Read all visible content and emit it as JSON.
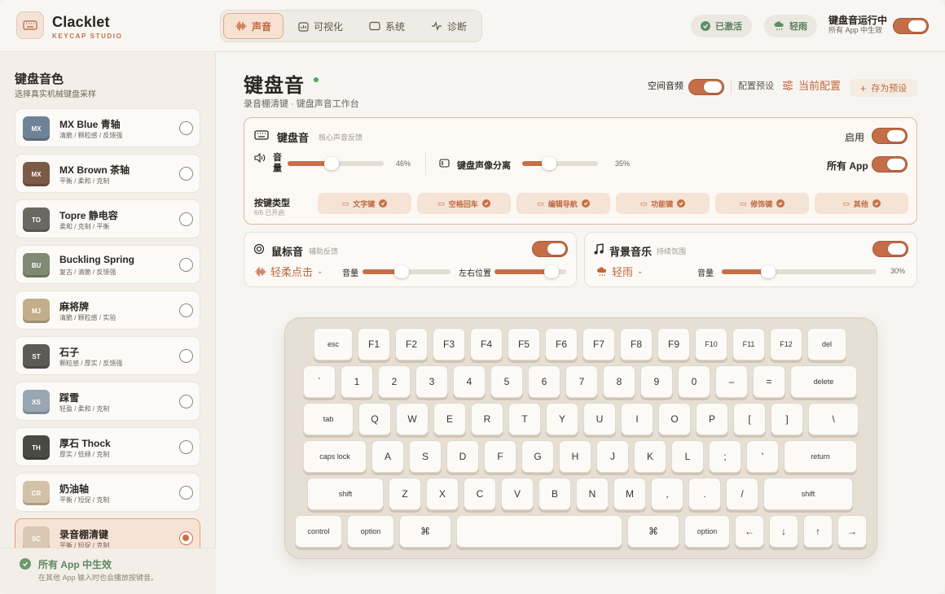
{
  "brand": {
    "title": "Clacklet",
    "subtitle": "KEYCAP STUDIO"
  },
  "nav": [
    {
      "label": "声音",
      "active": true
    },
    {
      "label": "可视化"
    },
    {
      "label": "系统"
    },
    {
      "label": "诊断"
    }
  ],
  "status": {
    "activated": "已激活",
    "weather": "轻雨",
    "running_title": "键盘音运行中",
    "running_sub": "所有 App 中生效"
  },
  "sidebar": {
    "title": "键盘音色",
    "subtitle": "选择真实机械键盘采样",
    "items": [
      {
        "code": "MX",
        "name": "MX Blue 青轴",
        "desc": "清脆 / 颗粒感 / 反馈强",
        "color": "#6f8296"
      },
      {
        "code": "MX",
        "name": "MX Brown 茶轴",
        "desc": "平衡 / 柔和 / 克制",
        "color": "#7c5a48"
      },
      {
        "code": "TO",
        "name": "Topre 静电容",
        "desc": "柔和 / 克制 / 平衡",
        "color": "#6b6862"
      },
      {
        "code": "BU",
        "name": "Buckling Spring",
        "desc": "复古 / 清脆 / 反馈强",
        "color": "#7f8a73"
      },
      {
        "code": "MJ",
        "name": "麻将牌",
        "desc": "清脆 / 颗粒感 / 实验",
        "color": "#c2ae8b"
      },
      {
        "code": "ST",
        "name": "石子",
        "desc": "颗粒感 / 厚实 / 反馈强",
        "color": "#5d5b55"
      },
      {
        "code": "XS",
        "name": "踩雪",
        "desc": "轻盈 / 柔和 / 克制",
        "color": "#98a7b3"
      },
      {
        "code": "TH",
        "name": "厚石 Thock",
        "desc": "厚实 / 低频 / 克制",
        "color": "#4a4a45"
      },
      {
        "code": "CR",
        "name": "奶油轴",
        "desc": "平衡 / 短促 / 克制",
        "color": "#d3c2a7"
      },
      {
        "code": "SC",
        "name": "录音棚清键",
        "desc": "平衡 / 短促 / 克制",
        "color": "#d7c9b4",
        "selected": true
      }
    ],
    "footer_title": "所有 App 中生效",
    "footer_sub": "在其他 App 输入时也会播放按键音。"
  },
  "main": {
    "title": "键盘音",
    "subtitle": "录音棚清键 · 键盘声音工作台",
    "spatial": "空间音频",
    "preset_label": "配置预设",
    "current_config": "当前配置",
    "save_preset": "存为预设",
    "keyboard_card": {
      "title": "键盘音",
      "hint": "核心声音反馈",
      "enable": "启用",
      "all_apps": "所有 App",
      "volume_label": "音量",
      "volume": 46,
      "volume_text": "46%",
      "stereo_label": "键盘声像分离",
      "stereo": 35,
      "stereo_text": "35%",
      "key_type_label": "按键类型",
      "key_type_count": "6/6 已开启",
      "key_types": [
        "文字键",
        "空格回车",
        "编辑导航",
        "功能键",
        "修饰键",
        "其他"
      ]
    },
    "mouse_card": {
      "title": "鼠标音",
      "hint": "辅助反馈",
      "preset": "轻柔点击",
      "volume_label": "音量",
      "volume": 44,
      "pan_label": "左右位置",
      "pan": 80
    },
    "music_card": {
      "title": "背景音乐",
      "hint": "持续氛围",
      "preset": "轻雨",
      "volume_label": "音量",
      "volume": 30,
      "volume_text": "30%"
    }
  },
  "keyboard": {
    "row1": [
      "esc",
      "F1",
      "F2",
      "F3",
      "F4",
      "F5",
      "F6",
      "F7",
      "F8",
      "F9",
      "F10",
      "F11",
      "F12",
      "del"
    ],
    "row2": [
      "`",
      "1",
      "2",
      "3",
      "4",
      "5",
      "6",
      "7",
      "8",
      "9",
      "0",
      "–",
      "=",
      "delete"
    ],
    "row3": [
      "tab",
      "Q",
      "W",
      "E",
      "R",
      "T",
      "Y",
      "U",
      "I",
      "O",
      "P",
      "[",
      "]",
      "\\"
    ],
    "row4": [
      "caps lock",
      "A",
      "S",
      "D",
      "F",
      "G",
      "H",
      "J",
      "K",
      "L",
      ";",
      "'",
      "return"
    ],
    "row5": [
      "shift",
      "Z",
      "X",
      "C",
      "V",
      "B",
      "N",
      "M",
      ",",
      ".",
      "/",
      "shift"
    ],
    "row6": [
      "control",
      "option",
      "⌘",
      "",
      "⌘",
      "option",
      "←",
      "↓",
      "↑",
      "→"
    ]
  }
}
